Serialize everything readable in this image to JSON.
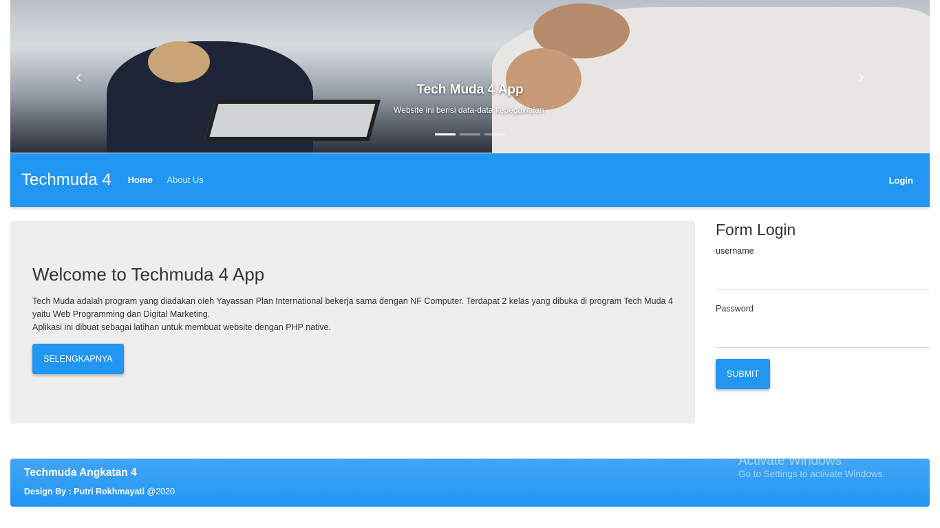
{
  "carousel": {
    "title": "Tech Muda 4 App",
    "subtitle": "Website ini berisi data-data kepegawaian.",
    "prev": "‹",
    "next": "›",
    "slides": 3,
    "active": 1
  },
  "navbar": {
    "brand": "Techmuda 4",
    "links": [
      "Home",
      "About Us"
    ],
    "login": "Login"
  },
  "jumbotron": {
    "title": "Welcome to Techmuda 4 App",
    "p1": "Tech Muda adalah program yang diadakan oleh Yayassan Plan International bekerja sama dengan NF Computer. Terdapat 2 kelas yang dibuka di program Tech Muda 4 yaitu Web Programming dan Digital Marketing.",
    "p2": "Aplikasi ini dibuat sebagai latihan untuk membuat website dengan PHP native.",
    "button": "SELENGKAPNYA"
  },
  "form": {
    "title": "Form Login",
    "username_label": "username",
    "password_label": "Password",
    "submit": "SUBMIT"
  },
  "footer": {
    "title": "Techmuda Angkatan 4",
    "design_by": "Design By : Putri Rokhmayati",
    "year": "@2020"
  },
  "watermark": {
    "title": "Activate Windows",
    "sub": "Go to Settings to activate Windows."
  }
}
